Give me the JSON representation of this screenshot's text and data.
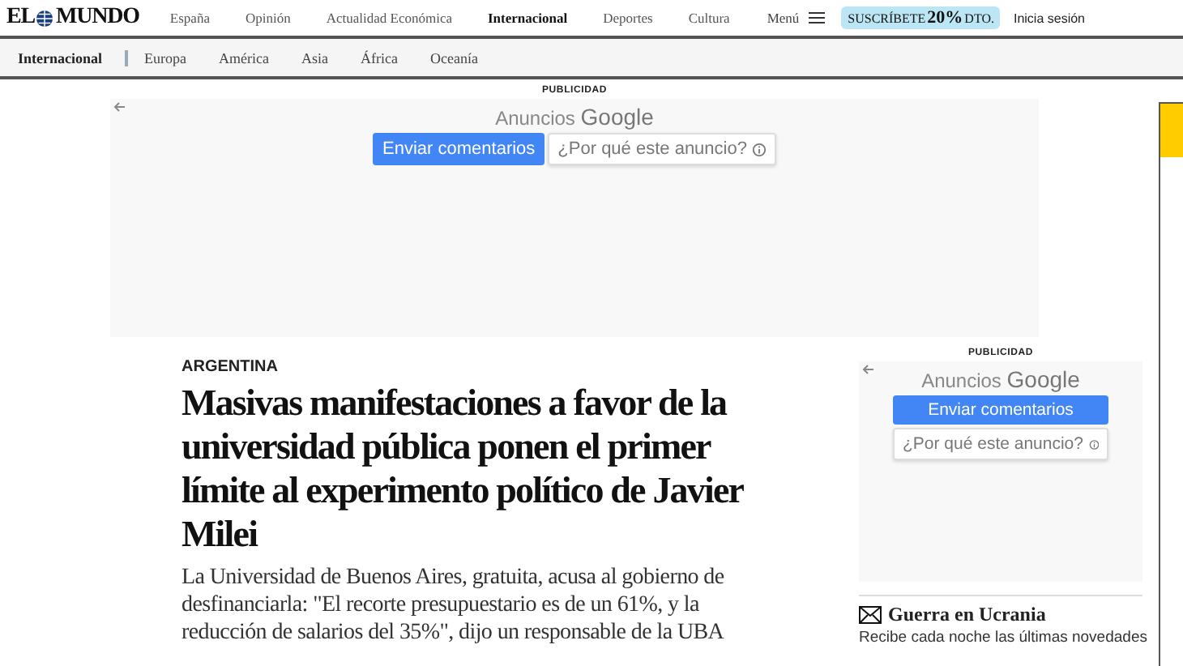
{
  "header": {
    "logo": {
      "left": "EL",
      "right": "MUNDO"
    },
    "nav": [
      {
        "label": "España",
        "selected": false
      },
      {
        "label": "Opinión",
        "selected": false
      },
      {
        "label": "Actualidad Económica",
        "selected": false
      },
      {
        "label": "Internacional",
        "selected": true
      },
      {
        "label": "Deportes",
        "selected": false
      },
      {
        "label": "Cultura",
        "selected": false
      }
    ],
    "menu": "Menú",
    "subscribe": {
      "text": "SUSCRÍBETE",
      "discount": "20%",
      "suffix": "DTO."
    },
    "login": "Inicia sesión"
  },
  "subnav": {
    "section": "Internacional",
    "items": [
      "Europa",
      "América",
      "Asia",
      "África",
      "Oceanía"
    ]
  },
  "top_ad": {
    "label": "PUBLICIDAD",
    "title": "Anuncios",
    "brand": "Google",
    "feedback": "Enviar comentarios",
    "why": "¿Por qué este anuncio?"
  },
  "article": {
    "kicker": "ARGENTINA",
    "headline": "Masivas manifestaciones a favor de la universidad pública ponen el primer límite al experimento político de Javier Milei",
    "standfirst": "La Universidad de Buenos Aires, gratuita, acusa al gobierno de desfinanciarla: \"El recorte presupuestario es de un 61%, y la reducción de salarios del 35%\", dijo un responsable de la UBA"
  },
  "side_ad": {
    "label": "PUBLICIDAD",
    "title": "Anuncios",
    "brand": "Google",
    "feedback": "Enviar comentarios",
    "why": "¿Por qué este anuncio?"
  },
  "newsletter": {
    "title": "Guerra en Ucrania",
    "text": "Recibe cada noche las últimas novedades"
  }
}
